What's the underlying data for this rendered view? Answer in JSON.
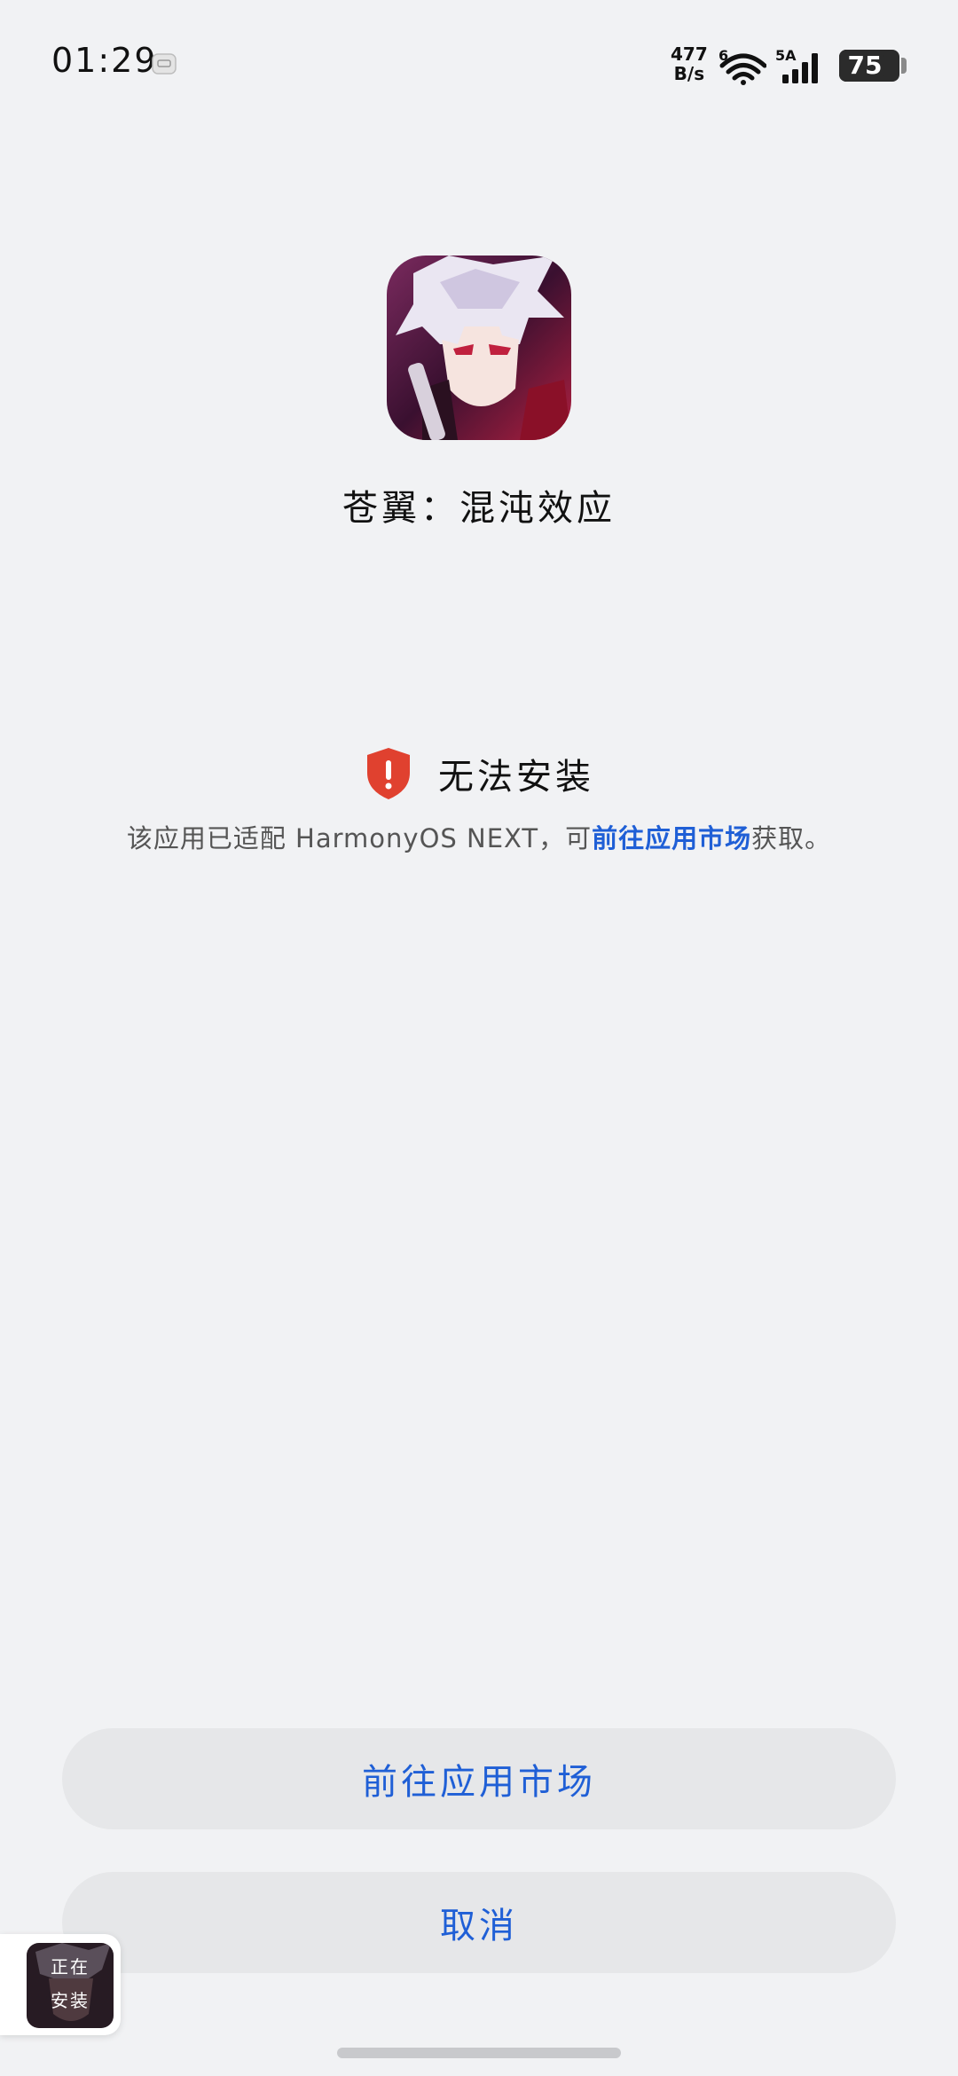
{
  "status_bar": {
    "time": "01:29",
    "net_speed_value": "477",
    "net_speed_unit": "B/s",
    "wifi_label": "6",
    "cell_label": "5A",
    "battery_level": "75"
  },
  "app": {
    "name": "苍翼：混沌效应",
    "icon": "anime-character-app-icon"
  },
  "warning": {
    "title": "无法安装",
    "desc_prefix": "该应用已适配 HarmonyOS NEXT，可",
    "desc_link": "前往应用市场",
    "desc_suffix": "获取。",
    "icon": "shield-alert-icon"
  },
  "buttons": {
    "market": "前往应用市场",
    "cancel": "取消"
  },
  "floating_widget": {
    "line1": "正在",
    "line2": "安装"
  },
  "colors": {
    "background": "#f1f2f4",
    "accent": "#1f5fd6",
    "warning": "#e0412f",
    "button_bg": "#e6e7e9"
  }
}
